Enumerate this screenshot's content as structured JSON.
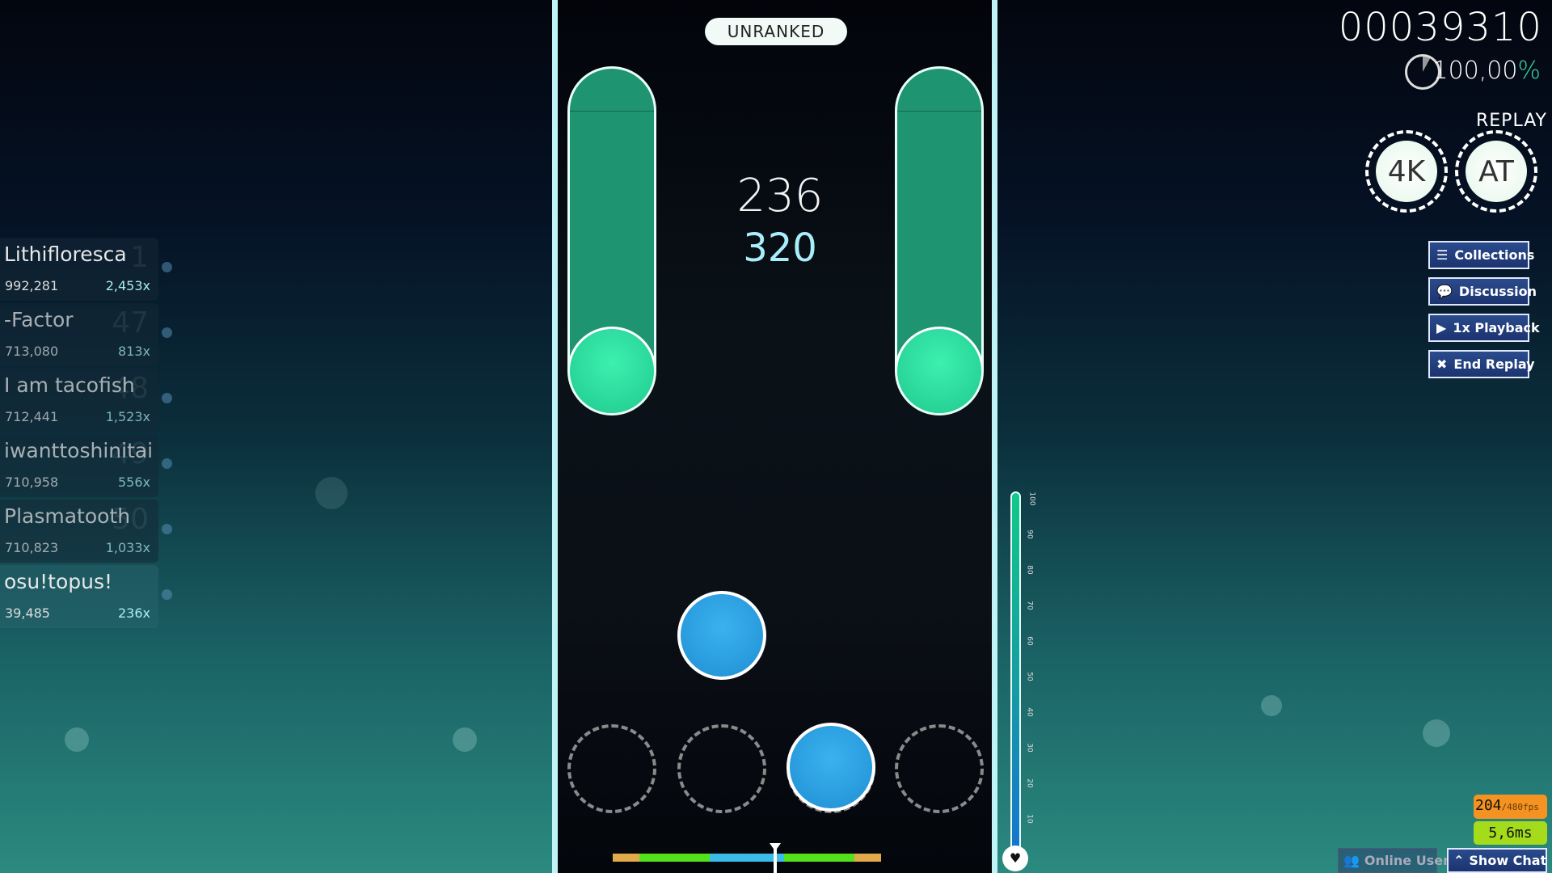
{
  "hud": {
    "status": "UNRANKED",
    "score": "00039310",
    "accuracy": "100,00",
    "accuracy_unit": "%",
    "combo": "236",
    "judgement": "320",
    "mode_label": "REPLAY",
    "health_percent": 100,
    "health_ticks": [
      "100",
      "90",
      "80",
      "70",
      "60",
      "50",
      "40",
      "30",
      "20",
      "10"
    ],
    "hit_error_colors": [
      "#e0aa4a",
      "#55e01c",
      "#3bbbe8",
      "#55e01c",
      "#e0aa4a"
    ]
  },
  "mods": [
    {
      "label": "4K"
    },
    {
      "label": "AT"
    }
  ],
  "leaderboard": [
    {
      "name": "Lithifloresca",
      "rank": "1",
      "score": "992,281",
      "combo": "2,453x"
    },
    {
      "name": "-Factor",
      "rank": "47",
      "score": "713,080",
      "combo": "813x"
    },
    {
      "name": "I am tacofish",
      "rank": "48",
      "score": "712,441",
      "combo": "1,523x"
    },
    {
      "name": "iwanttoshinitai",
      "rank": "49",
      "score": "710,958",
      "combo": "556x"
    },
    {
      "name": "Plasmatooth",
      "rank": "50",
      "score": "710,823",
      "combo": "1,033x"
    },
    {
      "name": "osu!topus!",
      "rank": "",
      "score": "39,485",
      "combo": "236x"
    }
  ],
  "replay_buttons": [
    {
      "label": "Collections",
      "icon": "list-icon"
    },
    {
      "label": "Discussion",
      "icon": "chat-bubbles-icon"
    },
    {
      "label": "1x Playback",
      "icon": "play-icon"
    },
    {
      "label": "End Replay",
      "icon": "close-icon"
    }
  ],
  "perf": {
    "fps": "204",
    "fps_max": "/480fps",
    "frametime": "5,6ms"
  },
  "bottom": {
    "online_users": "Online Users",
    "show_chat": "Show Chat"
  }
}
